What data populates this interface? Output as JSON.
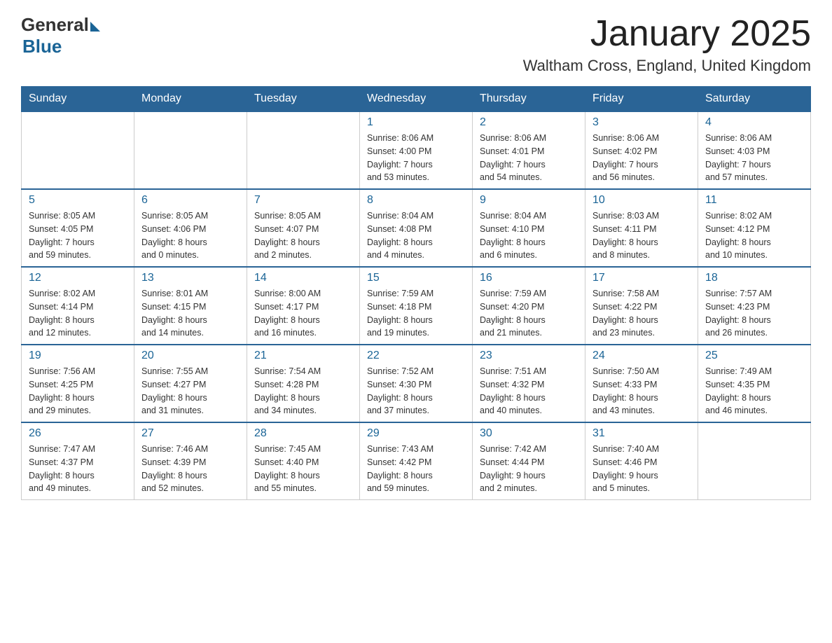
{
  "logo": {
    "general": "General",
    "blue": "Blue"
  },
  "title": "January 2025",
  "location": "Waltham Cross, England, United Kingdom",
  "days_of_week": [
    "Sunday",
    "Monday",
    "Tuesday",
    "Wednesday",
    "Thursday",
    "Friday",
    "Saturday"
  ],
  "weeks": [
    [
      {
        "day": "",
        "info": ""
      },
      {
        "day": "",
        "info": ""
      },
      {
        "day": "",
        "info": ""
      },
      {
        "day": "1",
        "info": "Sunrise: 8:06 AM\nSunset: 4:00 PM\nDaylight: 7 hours\nand 53 minutes."
      },
      {
        "day": "2",
        "info": "Sunrise: 8:06 AM\nSunset: 4:01 PM\nDaylight: 7 hours\nand 54 minutes."
      },
      {
        "day": "3",
        "info": "Sunrise: 8:06 AM\nSunset: 4:02 PM\nDaylight: 7 hours\nand 56 minutes."
      },
      {
        "day": "4",
        "info": "Sunrise: 8:06 AM\nSunset: 4:03 PM\nDaylight: 7 hours\nand 57 minutes."
      }
    ],
    [
      {
        "day": "5",
        "info": "Sunrise: 8:05 AM\nSunset: 4:05 PM\nDaylight: 7 hours\nand 59 minutes."
      },
      {
        "day": "6",
        "info": "Sunrise: 8:05 AM\nSunset: 4:06 PM\nDaylight: 8 hours\nand 0 minutes."
      },
      {
        "day": "7",
        "info": "Sunrise: 8:05 AM\nSunset: 4:07 PM\nDaylight: 8 hours\nand 2 minutes."
      },
      {
        "day": "8",
        "info": "Sunrise: 8:04 AM\nSunset: 4:08 PM\nDaylight: 8 hours\nand 4 minutes."
      },
      {
        "day": "9",
        "info": "Sunrise: 8:04 AM\nSunset: 4:10 PM\nDaylight: 8 hours\nand 6 minutes."
      },
      {
        "day": "10",
        "info": "Sunrise: 8:03 AM\nSunset: 4:11 PM\nDaylight: 8 hours\nand 8 minutes."
      },
      {
        "day": "11",
        "info": "Sunrise: 8:02 AM\nSunset: 4:12 PM\nDaylight: 8 hours\nand 10 minutes."
      }
    ],
    [
      {
        "day": "12",
        "info": "Sunrise: 8:02 AM\nSunset: 4:14 PM\nDaylight: 8 hours\nand 12 minutes."
      },
      {
        "day": "13",
        "info": "Sunrise: 8:01 AM\nSunset: 4:15 PM\nDaylight: 8 hours\nand 14 minutes."
      },
      {
        "day": "14",
        "info": "Sunrise: 8:00 AM\nSunset: 4:17 PM\nDaylight: 8 hours\nand 16 minutes."
      },
      {
        "day": "15",
        "info": "Sunrise: 7:59 AM\nSunset: 4:18 PM\nDaylight: 8 hours\nand 19 minutes."
      },
      {
        "day": "16",
        "info": "Sunrise: 7:59 AM\nSunset: 4:20 PM\nDaylight: 8 hours\nand 21 minutes."
      },
      {
        "day": "17",
        "info": "Sunrise: 7:58 AM\nSunset: 4:22 PM\nDaylight: 8 hours\nand 23 minutes."
      },
      {
        "day": "18",
        "info": "Sunrise: 7:57 AM\nSunset: 4:23 PM\nDaylight: 8 hours\nand 26 minutes."
      }
    ],
    [
      {
        "day": "19",
        "info": "Sunrise: 7:56 AM\nSunset: 4:25 PM\nDaylight: 8 hours\nand 29 minutes."
      },
      {
        "day": "20",
        "info": "Sunrise: 7:55 AM\nSunset: 4:27 PM\nDaylight: 8 hours\nand 31 minutes."
      },
      {
        "day": "21",
        "info": "Sunrise: 7:54 AM\nSunset: 4:28 PM\nDaylight: 8 hours\nand 34 minutes."
      },
      {
        "day": "22",
        "info": "Sunrise: 7:52 AM\nSunset: 4:30 PM\nDaylight: 8 hours\nand 37 minutes."
      },
      {
        "day": "23",
        "info": "Sunrise: 7:51 AM\nSunset: 4:32 PM\nDaylight: 8 hours\nand 40 minutes."
      },
      {
        "day": "24",
        "info": "Sunrise: 7:50 AM\nSunset: 4:33 PM\nDaylight: 8 hours\nand 43 minutes."
      },
      {
        "day": "25",
        "info": "Sunrise: 7:49 AM\nSunset: 4:35 PM\nDaylight: 8 hours\nand 46 minutes."
      }
    ],
    [
      {
        "day": "26",
        "info": "Sunrise: 7:47 AM\nSunset: 4:37 PM\nDaylight: 8 hours\nand 49 minutes."
      },
      {
        "day": "27",
        "info": "Sunrise: 7:46 AM\nSunset: 4:39 PM\nDaylight: 8 hours\nand 52 minutes."
      },
      {
        "day": "28",
        "info": "Sunrise: 7:45 AM\nSunset: 4:40 PM\nDaylight: 8 hours\nand 55 minutes."
      },
      {
        "day": "29",
        "info": "Sunrise: 7:43 AM\nSunset: 4:42 PM\nDaylight: 8 hours\nand 59 minutes."
      },
      {
        "day": "30",
        "info": "Sunrise: 7:42 AM\nSunset: 4:44 PM\nDaylight: 9 hours\nand 2 minutes."
      },
      {
        "day": "31",
        "info": "Sunrise: 7:40 AM\nSunset: 4:46 PM\nDaylight: 9 hours\nand 5 minutes."
      },
      {
        "day": "",
        "info": ""
      }
    ]
  ]
}
